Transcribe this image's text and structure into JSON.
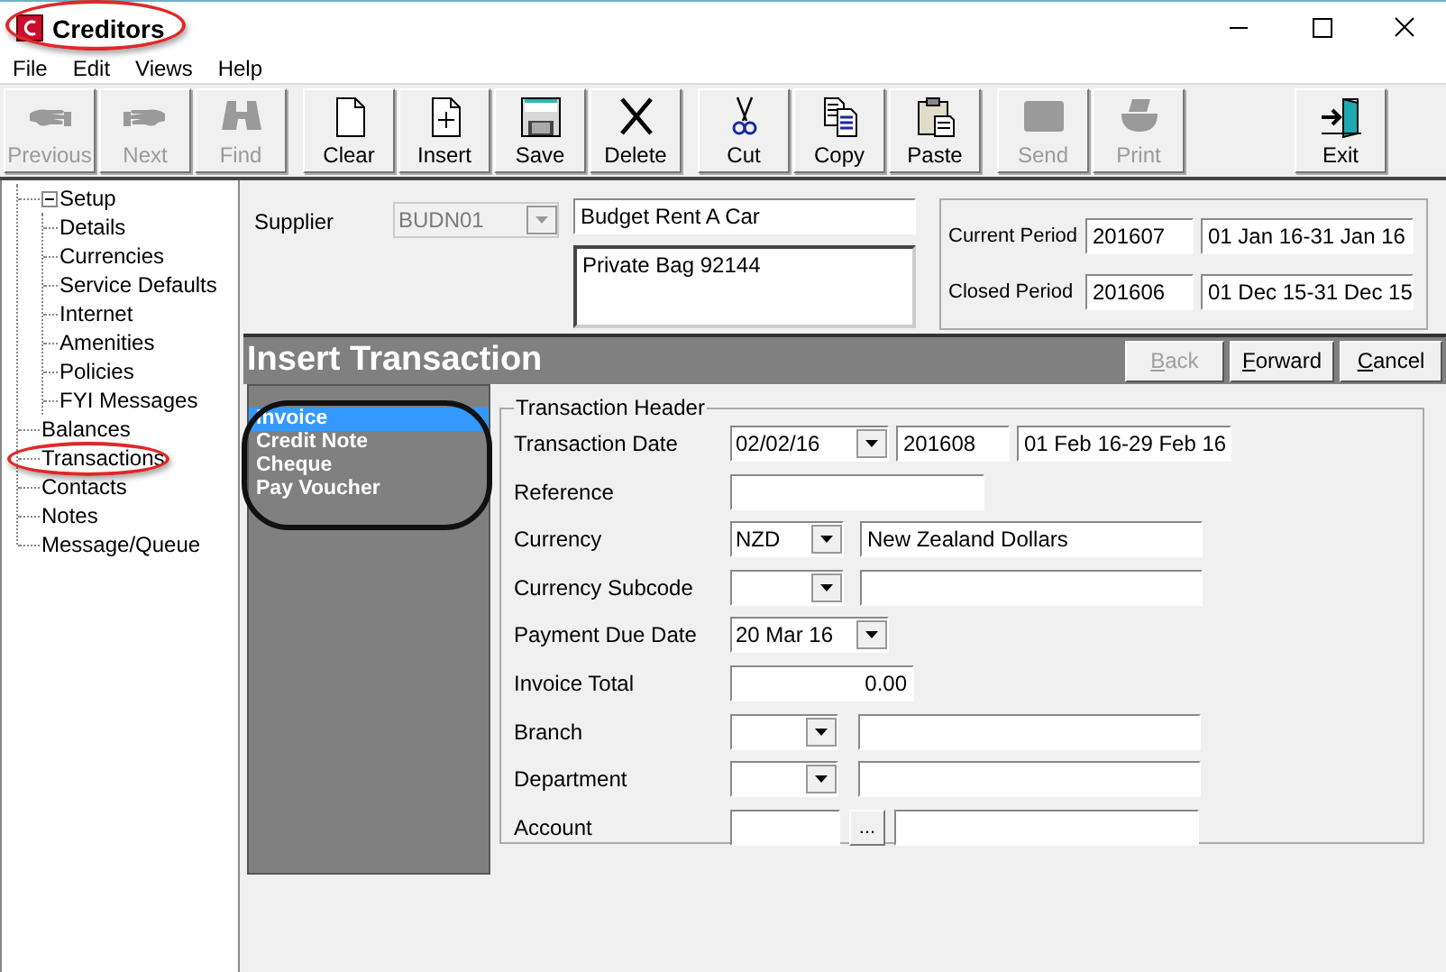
{
  "window": {
    "title": "Creditors",
    "highlighted": true
  },
  "menu": [
    "File",
    "Edit",
    "Views",
    "Help"
  ],
  "toolbar": [
    {
      "buttons": [
        {
          "label": "Previous",
          "disabled": true
        },
        {
          "label": "Next",
          "disabled": true
        },
        {
          "label": "Find",
          "disabled": true
        }
      ]
    },
    {
      "buttons": [
        {
          "label": "Clear",
          "disabled": false
        },
        {
          "label": "Insert",
          "disabled": false
        },
        {
          "label": "Save",
          "disabled": false
        },
        {
          "label": "Delete",
          "disabled": false
        }
      ]
    },
    {
      "buttons": [
        {
          "label": "Cut",
          "disabled": false
        },
        {
          "label": "Copy",
          "disabled": false
        },
        {
          "label": "Paste",
          "disabled": false
        }
      ]
    },
    {
      "buttons": [
        {
          "label": "Send",
          "disabled": true
        },
        {
          "label": "Print",
          "disabled": true
        }
      ]
    },
    {
      "buttons": [
        {
          "label": "Exit",
          "disabled": false
        }
      ]
    }
  ],
  "tree": [
    {
      "label": "Setup",
      "expanded": true,
      "highlighted": false,
      "children": [
        {
          "label": "Details",
          "highlighted": false
        },
        {
          "label": "Currencies",
          "highlighted": false
        },
        {
          "label": "Service Defaults",
          "highlighted": false
        },
        {
          "label": "Internet",
          "highlighted": false
        },
        {
          "label": "Amenities",
          "highlighted": false
        },
        {
          "label": "Policies",
          "highlighted": false
        },
        {
          "label": "FYI Messages",
          "highlighted": false
        }
      ]
    },
    {
      "label": "Balances",
      "highlighted": false
    },
    {
      "label": "Transactions",
      "highlighted": true
    },
    {
      "label": "Contacts",
      "highlighted": false
    },
    {
      "label": "Notes",
      "highlighted": false
    },
    {
      "label": "Message/Queue",
      "highlighted": false
    }
  ],
  "supplier": {
    "label": "Supplier",
    "code": "BUDN01",
    "code_disabled": true,
    "name": "Budget Rent A Car",
    "address": "Private Bag 92144"
  },
  "periods": [
    {
      "label": "Current Period",
      "code": "201607",
      "range": "01 Jan 16-31 Jan 16"
    },
    {
      "label": "Closed Period",
      "code": "201606",
      "range": "01 Dec 15-31 Dec 15"
    }
  ],
  "panel": {
    "title": "Insert Transaction",
    "buttons": [
      {
        "label": "Back",
        "disabled": true
      },
      {
        "label": "Forward",
        "disabled": false
      },
      {
        "label": "Cancel",
        "disabled": false
      }
    ]
  },
  "transaction_types": {
    "highlighted": true,
    "items": [
      {
        "label": "Invoice",
        "selected": true
      },
      {
        "label": "Credit Note",
        "selected": false
      },
      {
        "label": "Cheque",
        "selected": false
      },
      {
        "label": "Pay Voucher",
        "selected": false
      }
    ]
  },
  "form": {
    "title": "Transaction Header",
    "rows": [
      {
        "label": "Transaction Date",
        "fields": [
          {
            "kind": "combo",
            "value": "02/02/16"
          },
          {
            "kind": "text",
            "value": "201608"
          },
          {
            "kind": "text",
            "value": "01 Feb 16-29 Feb 16"
          }
        ]
      },
      {
        "label": "Reference",
        "fields": [
          {
            "kind": "text"
          }
        ]
      },
      {
        "label": "Currency",
        "fields": [
          {
            "kind": "combo",
            "value": "NZD"
          },
          {
            "kind": "text",
            "value": "New Zealand Dollars"
          }
        ]
      },
      {
        "label": "Currency Subcode",
        "fields": [
          {
            "kind": "combo"
          },
          {
            "kind": "text"
          }
        ]
      },
      {
        "label": "Payment Due Date",
        "fields": [
          {
            "kind": "combo",
            "value": "20 Mar 16"
          }
        ]
      },
      {
        "label": "Invoice Total",
        "fields": [
          {
            "kind": "number",
            "value": "0.00"
          }
        ]
      },
      {
        "label": "Branch",
        "fields": [
          {
            "kind": "combo"
          },
          {
            "kind": "text"
          }
        ]
      },
      {
        "label": "Department",
        "fields": [
          {
            "kind": "combo"
          },
          {
            "kind": "text"
          }
        ]
      },
      {
        "label": "Account",
        "fields": [
          {
            "kind": "text"
          },
          {
            "kind": "button",
            "value": "..."
          },
          {
            "kind": "text"
          }
        ]
      }
    ]
  }
}
